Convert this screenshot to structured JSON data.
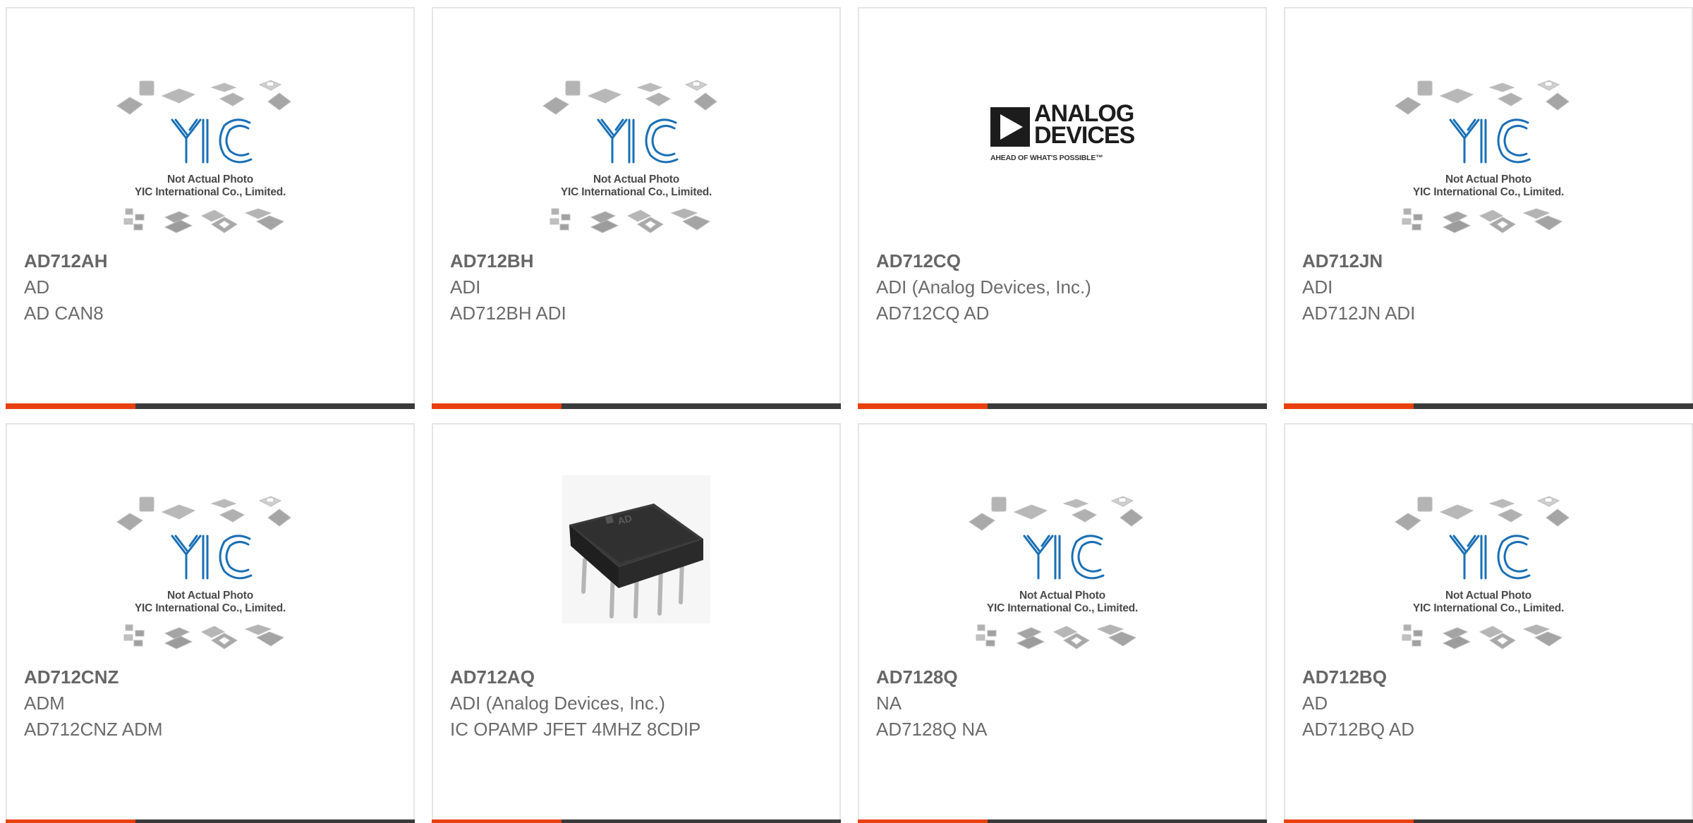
{
  "products": [
    {
      "part": "AD712AH",
      "manufacturer": "AD",
      "description": "AD CAN8",
      "image": "yic-placeholder"
    },
    {
      "part": "AD712BH",
      "manufacturer": "ADI",
      "description": "AD712BH ADI",
      "image": "yic-placeholder"
    },
    {
      "part": "AD712CQ",
      "manufacturer": "ADI (Analog Devices, Inc.)",
      "description": "AD712CQ AD",
      "image": "analog-devices-logo"
    },
    {
      "part": "AD712JN",
      "manufacturer": "ADI",
      "description": "AD712JN ADI",
      "image": "yic-placeholder"
    },
    {
      "part": "AD712CNZ",
      "manufacturer": "ADM",
      "description": "AD712CNZ ADM",
      "image": "yic-placeholder"
    },
    {
      "part": "AD712AQ",
      "manufacturer": "ADI (Analog Devices, Inc.)",
      "description": "IC OPAMP JFET 4MHZ 8CDIP",
      "image": "dip8-chip-photo"
    },
    {
      "part": "AD7128Q",
      "manufacturer": "NA",
      "description": "AD7128Q NA",
      "image": "yic-placeholder"
    },
    {
      "part": "AD712BQ",
      "manufacturer": "AD",
      "description": "AD712BQ AD",
      "image": "yic-placeholder"
    }
  ],
  "placeholder": {
    "line1": "Not Actual Photo",
    "line2": "YIC International Co., Limited."
  },
  "adi_logo": {
    "line1": "ANALOG",
    "line2": "DEVICES",
    "tagline": "AHEAD OF WHAT'S POSSIBLE™"
  },
  "chip_marking": "AD",
  "colors": {
    "accent": "#e8400f",
    "bar": "#3a3a3a",
    "yic_blue": "#1a6fb5",
    "text": "#6b6b6b",
    "border": "#e5e5e5"
  }
}
